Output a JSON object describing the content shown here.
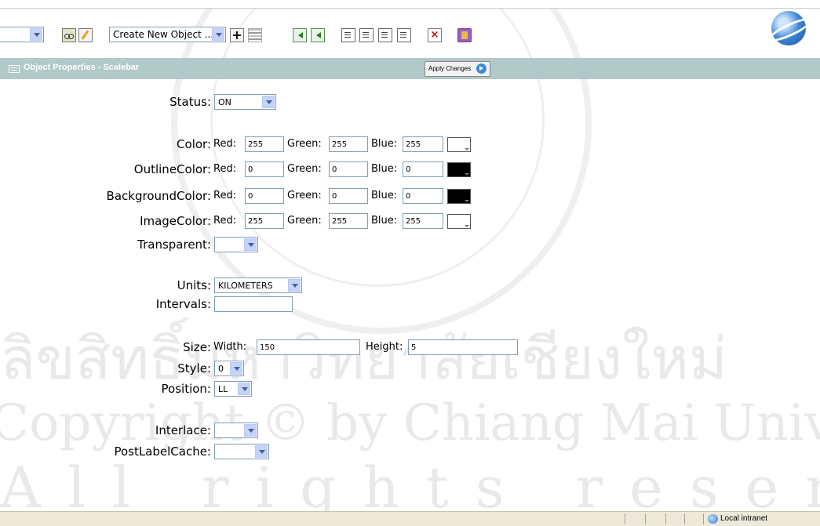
{
  "toolbar": {
    "left_dropdown_value": "",
    "create_object_value": "Create New Object ...",
    "icons": [
      "binoculars-icon",
      "edit-icon",
      "add-icon",
      "layers-icon",
      "arrow-icon",
      "arrow-icon",
      "document-icon",
      "document-icon",
      "document-icon",
      "document-icon",
      "delete-icon",
      "book-icon",
      "globe-icon"
    ]
  },
  "props_header": {
    "title": "Object Properties - Scalebar",
    "apply_label": "Apply Changes"
  },
  "form": {
    "status": {
      "label": "Status:",
      "value": "ON"
    },
    "color": {
      "label": "Color:",
      "red": "255",
      "green": "255",
      "blue": "255",
      "swatch": "#ffffff"
    },
    "outline": {
      "label": "OutlineColor:",
      "red": "0",
      "green": "0",
      "blue": "0",
      "swatch": "#000000"
    },
    "background": {
      "label": "BackgroundColor:",
      "red": "0",
      "green": "0",
      "blue": "0",
      "swatch": "#000000"
    },
    "image": {
      "label": "ImageColor:",
      "red": "255",
      "green": "255",
      "blue": "255",
      "swatch": "#ffffff"
    },
    "rgb_labels": {
      "red": "Red:",
      "green": "Green:",
      "blue": "Blue:"
    },
    "transparent": {
      "label": "Transparent:",
      "value": ""
    },
    "units": {
      "label": "Units:",
      "value": "KILOMETERS"
    },
    "intervals": {
      "label": "Intervals:",
      "value": ""
    },
    "size": {
      "label": "Size:",
      "width_label": "Width:",
      "width": "150",
      "height_label": "Height:",
      "height": "5"
    },
    "style": {
      "label": "Style:",
      "value": "0"
    },
    "position": {
      "label": "Position:",
      "value": "LL"
    },
    "interlace": {
      "label": "Interlace:",
      "value": ""
    },
    "postlabelcache": {
      "label": "PostLabelCache:",
      "value": ""
    }
  },
  "watermark": {
    "line1": "ลิขสิทธิ์มหาวิทยาลัยเชียงใหม่",
    "line2": "Copyright © by Chiang Mai University",
    "line3": "All rights reserved"
  },
  "statusbar": {
    "zone": "Local intranet"
  },
  "colors": {
    "header_bar": "#b1c9c9",
    "statusbar": "#ece9d8",
    "input_border": "#7f9db9"
  }
}
